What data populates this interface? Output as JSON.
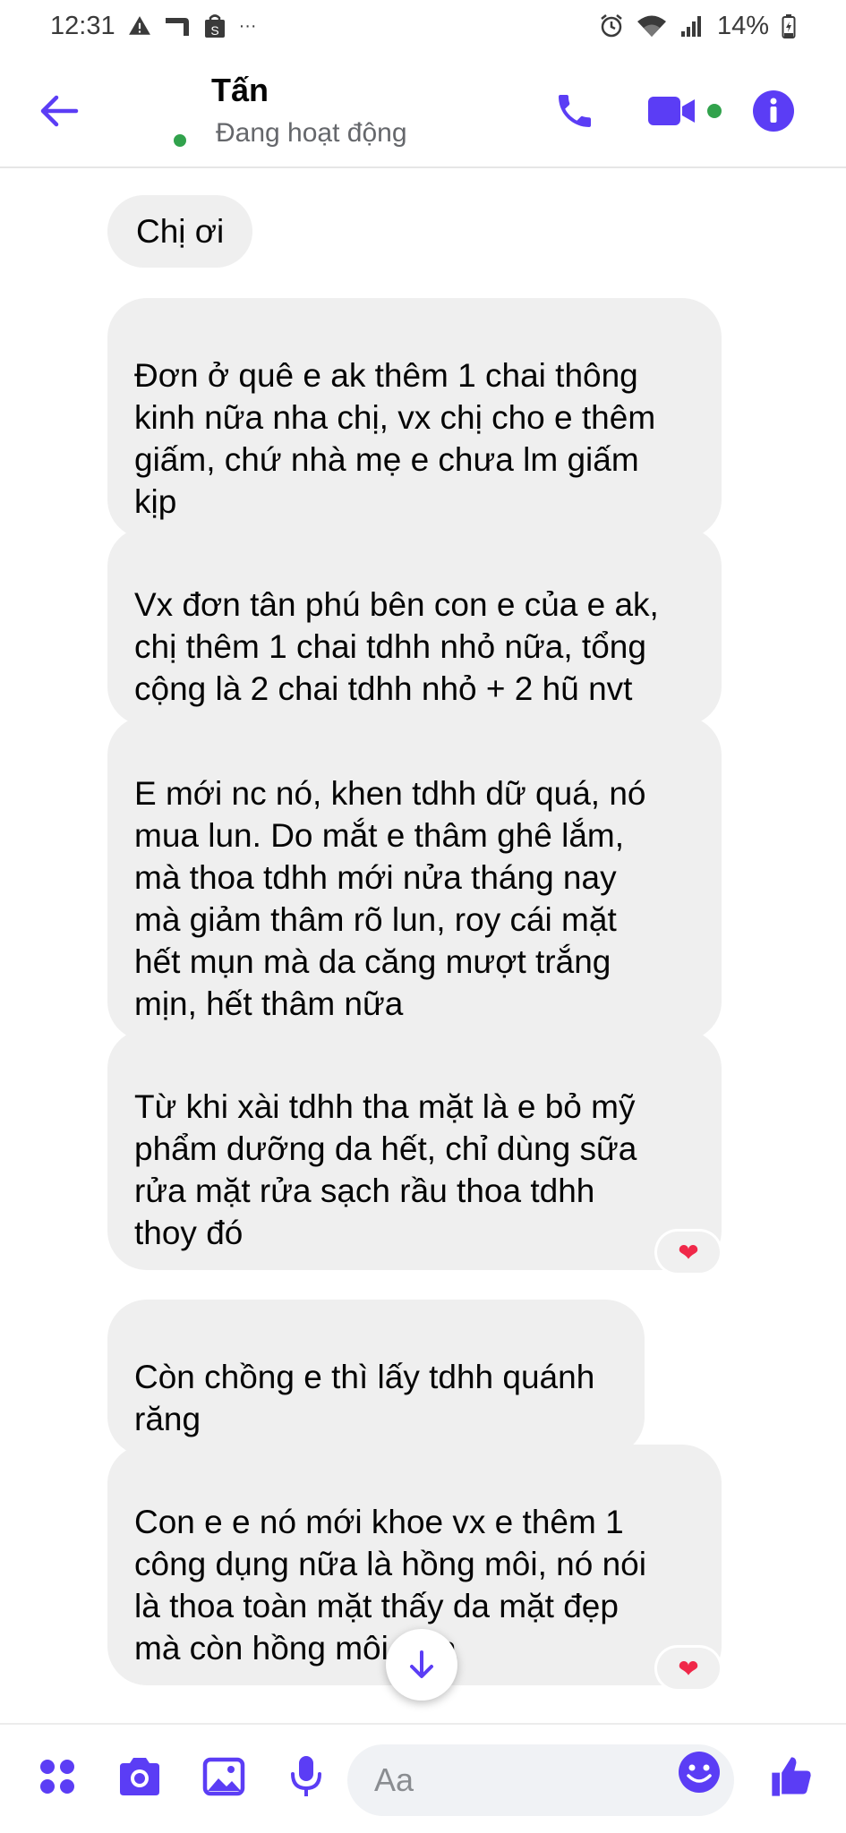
{
  "status_bar": {
    "time": "12:31",
    "more": "···",
    "battery": "14%"
  },
  "header": {
    "name": "Tấn",
    "status": "Đang hoạt động"
  },
  "messages": [
    {
      "text": "Chị ơi",
      "reaction": null
    },
    {
      "text": "Đơn ở quê e ak thêm 1 chai thông\nkinh nữa nha chị, vx chị cho e thêm\ngiấm, chứ nhà mẹ e chưa lm giấm\nkịp",
      "reaction": null
    },
    {
      "text": "Vx đơn tân phú bên con e của e ak,\nchị thêm 1 chai tdhh nhỏ nữa, tổng\ncộng là 2 chai tdhh nhỏ + 2 hũ nvt",
      "reaction": null
    },
    {
      "text": "E mới nc nó, khen tdhh dữ quá, nó\nmua lun. Do mắt e thâm ghê lắm,\nmà thoa tdhh mới nửa tháng nay\nmà giảm thâm rõ lun, roy cái mặt\nhết mụn mà da căng mượt trắng\nmịn, hết thâm nữa",
      "reaction": null
    },
    {
      "text": "Từ khi xài tdhh tha mặt là e bỏ mỹ\nphẩm dưỡng da hết, chỉ dùng sữa\nrửa mặt rửa sạch rầu thoa tdhh\nthoy đó",
      "reaction": "❤"
    },
    {
      "text": "Còn chồng e thì lấy tdhh quánh\nrăng",
      "reaction": null
    },
    {
      "text": "Con e e nó mới khoe vx e thêm 1\ncông dụng nữa là hồng môi, nó nói\nlà thoa toàn mặt thấy da mặt đẹp\nmà còn hồng môi nữa",
      "reaction": "❤"
    }
  ],
  "composer": {
    "placeholder": "Aa"
  },
  "icons": {
    "back": "arrow-left-icon",
    "call": "phone-icon",
    "video": "video-camera-icon",
    "info": "info-icon",
    "apps": "four-dots-icon",
    "camera": "camera-icon",
    "gallery": "image-icon",
    "voice": "microphone-icon",
    "emoji": "smile-icon",
    "like": "thumbs-up-icon",
    "scroll_down": "arrow-down-icon"
  },
  "colors": {
    "accent": "#5b3df5",
    "bubble": "#efefef",
    "online": "#31a24c",
    "heart": "#f02849"
  }
}
